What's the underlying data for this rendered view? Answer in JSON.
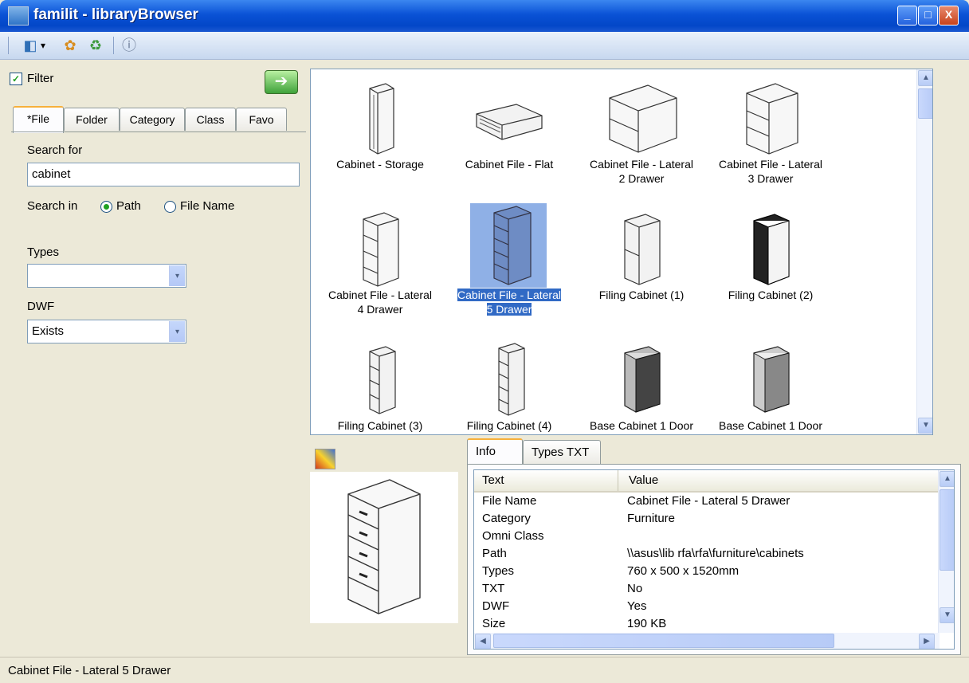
{
  "window": {
    "title": "familit - libraryBrowser",
    "min": "_",
    "max": "□",
    "close": "X"
  },
  "toolbar": {
    "open_icon": "◧",
    "caret": "▾",
    "gear_icon": "✿",
    "refresh_icon": "♻",
    "info_icon": "ⓘ"
  },
  "filter": {
    "label": "Filter",
    "checked": "✓",
    "go": "➔"
  },
  "tabs": [
    "*File",
    "Folder",
    "Category",
    "Class",
    "Favo"
  ],
  "search": {
    "label": "Search for",
    "value": "cabinet",
    "search_in_label": "Search in",
    "opt_path": "Path",
    "opt_filename": "File Name"
  },
  "types": {
    "label": "Types",
    "value": ""
  },
  "dwf": {
    "label": "DWF",
    "value": "Exists"
  },
  "dropdown_arrow": "▾",
  "scroll_up": "▲",
  "scroll_down": "▼",
  "scroll_left": "◀",
  "scroll_right": "▶",
  "gallery": [
    {
      "line1": "Cabinet - Storage",
      "line2": ""
    },
    {
      "line1": "Cabinet File - Flat",
      "line2": ""
    },
    {
      "line1": "Cabinet File - Lateral",
      "line2": "2 Drawer"
    },
    {
      "line1": "Cabinet File - Lateral",
      "line2": "3 Drawer"
    },
    {
      "line1": "Cabinet File - Lateral",
      "line2": "4 Drawer"
    },
    {
      "line1": "Cabinet File - Lateral",
      "line2": "5 Drawer"
    },
    {
      "line1": "Filing Cabinet (1)",
      "line2": ""
    },
    {
      "line1": "Filing Cabinet (2)",
      "line2": ""
    },
    {
      "line1": "Filing Cabinet (3)",
      "line2": ""
    },
    {
      "line1": "Filing Cabinet (4)",
      "line2": ""
    },
    {
      "line1": "Base Cabinet 1 Door",
      "line2": ""
    },
    {
      "line1": "Base Cabinet 1 Door",
      "line2": ""
    }
  ],
  "info": {
    "tabs": [
      "Info",
      "Types TXT"
    ],
    "col_text": "Text",
    "col_value": "Value",
    "rows": [
      {
        "k": "File Name",
        "v": "Cabinet File - Lateral 5 Drawer"
      },
      {
        "k": "Category",
        "v": "Furniture"
      },
      {
        "k": "Omni Class",
        "v": ""
      },
      {
        "k": "Path",
        "v": "\\\\asus\\lib rfa\\rfa\\furniture\\cabinets"
      },
      {
        "k": "Types",
        "v": "760 x 500 x 1520mm"
      },
      {
        "k": "TXT",
        "v": " No"
      },
      {
        "k": "DWF",
        "v": "Yes"
      },
      {
        "k": "Size",
        "v": "190 KB"
      }
    ]
  },
  "status": "Cabinet File - Lateral 5 Drawer"
}
